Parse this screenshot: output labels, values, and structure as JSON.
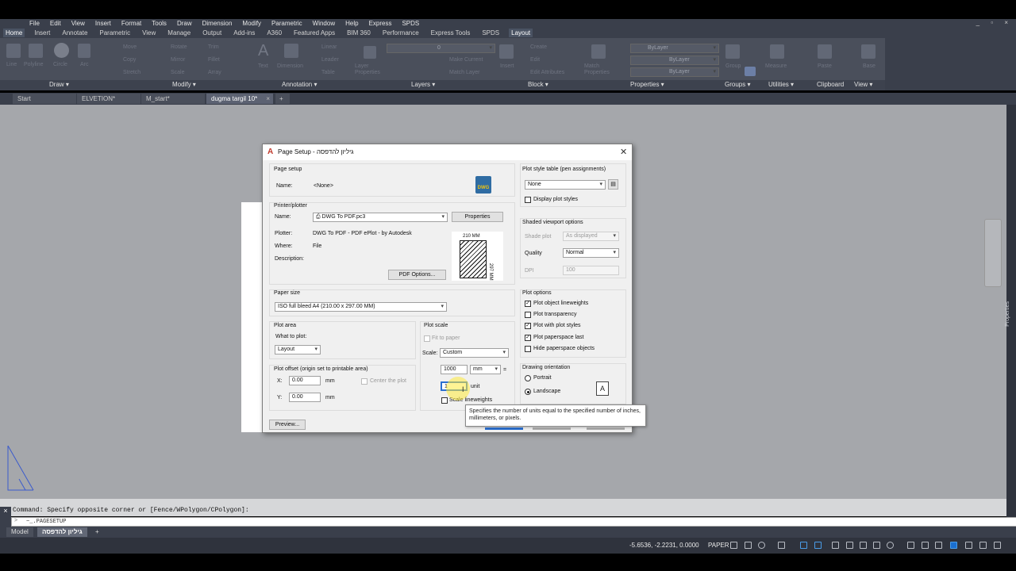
{
  "menu": [
    "File",
    "Edit",
    "View",
    "Insert",
    "Format",
    "Tools",
    "Draw",
    "Dimension",
    "Modify",
    "Parametric",
    "Window",
    "Help",
    "Express",
    "SPDS"
  ],
  "window_controls": "_ ▫ ×",
  "ribbon_tabs": [
    "Home",
    "Insert",
    "Annotate",
    "Parametric",
    "View",
    "Manage",
    "Output",
    "Add-ins",
    "A360",
    "Featured Apps",
    "BIM 360",
    "Performance",
    "Express Tools",
    "SPDS",
    "Layout"
  ],
  "ribbon_active_tab": "Home",
  "ribbon_panels": {
    "draw": "Draw ▾",
    "modify": "Modify ▾",
    "annotation": "Annotation ▾",
    "layers": "Layers ▾",
    "block": "Block ▾",
    "properties": "Properties ▾",
    "groups": "Groups ▾",
    "utilities": "Utilities ▾",
    "clipboard": "Clipboard",
    "view": "View ▾"
  },
  "ribbon_tools": {
    "line": "Line",
    "polyline": "Polyline",
    "circle": "Circle",
    "arc": "Arc",
    "move": "Move",
    "rotate": "Rotate",
    "trim": "Trim",
    "copy": "Copy",
    "mirror": "Mirror",
    "fillet": "Fillet",
    "stretch": "Stretch",
    "scale": "Scale",
    "array": "Array",
    "text": "Text",
    "dimension": "Dimension",
    "linear": "Linear",
    "leader": "Leader",
    "table": "Table",
    "layer_properties": "Layer Properties",
    "make_current": "Make Current",
    "match_layer": "Match Layer",
    "layer_value": "0",
    "insert": "Insert",
    "create": "Create",
    "edit": "Edit",
    "edit_attributes": "Edit Attributes",
    "match_properties": "Match Properties",
    "bylayer": "ByLayer",
    "group": "Group",
    "measure": "Measure",
    "paste": "Paste",
    "base": "Base"
  },
  "file_tabs": [
    {
      "label": "Start",
      "active": false
    },
    {
      "label": "ELVETION*",
      "active": false
    },
    {
      "label": "M_start*",
      "active": false
    },
    {
      "label": "dugma targil 10*",
      "active": true
    }
  ],
  "dialog": {
    "title": "Page Setup - גיליון להדפסה",
    "page_setup": {
      "group": "Page setup",
      "name_label": "Name:",
      "name_value": "<None>",
      "dwg_label": "DWG"
    },
    "printer": {
      "group": "Printer/plotter",
      "name_label": "Name:",
      "name_value": "DWG To PDF.pc3",
      "properties_btn": "Properties",
      "plotter_label": "Plotter:",
      "plotter_value": "DWG To PDF - PDF ePlot - by Autodesk",
      "where_label": "Where:",
      "where_value": "File",
      "description_label": "Description:",
      "pdf_options_btn": "PDF Options...",
      "preview_width": "210 MM",
      "preview_height": "297 MM"
    },
    "paper_size": {
      "group": "Paper size",
      "value": "ISO full bleed A4 (210.00 x 297.00 MM)"
    },
    "plot_area": {
      "group": "Plot area",
      "what_label": "What to plot:",
      "what_value": "Layout"
    },
    "plot_offset": {
      "group": "Plot offset (origin set to printable area)",
      "x_label": "X:",
      "x_value": "0.00",
      "x_unit": "mm",
      "y_label": "Y:",
      "y_value": "0.00",
      "y_unit": "mm",
      "center_label": "Center the plot"
    },
    "plot_scale": {
      "group": "Plot scale",
      "fit_label": "Fit to paper",
      "scale_label": "Scale:",
      "scale_value": "Custom",
      "value1": "1000",
      "unit1": "mm",
      "equals": "=",
      "value2": "1",
      "unit2": "unit",
      "scale_lineweights": "Scale lineweights"
    },
    "plot_style_table": {
      "group": "Plot style table (pen assignments)",
      "value": "None",
      "display_label": "Display plot styles"
    },
    "shaded_viewport": {
      "group": "Shaded viewport options",
      "shade_label": "Shade plot",
      "shade_value": "As displayed",
      "quality_label": "Quality",
      "quality_value": "Normal",
      "dpi_label": "DPI",
      "dpi_value": "100"
    },
    "plot_options": {
      "group": "Plot options",
      "items": [
        {
          "label": "Plot object lineweights",
          "checked": true
        },
        {
          "label": "Plot transparency",
          "checked": false
        },
        {
          "label": "Plot with plot styles",
          "checked": true
        },
        {
          "label": "Plot paperspace last",
          "checked": true
        },
        {
          "label": "Hide paperspace objects",
          "checked": false
        }
      ]
    },
    "orientation": {
      "group": "Drawing orientation",
      "portrait": "Portrait",
      "landscape": "Landscape",
      "selected": "Landscape",
      "icon_glyph": "A"
    },
    "preview_btn": "Preview...",
    "tooltip": "Specifies the number of units equal to the specified number of inches, millimeters, or pixels."
  },
  "command_line": {
    "history": "Command: Specify opposite corner or [Fence/WPolygon/CPolygon]:",
    "input": "~_.PAGESETUP",
    "prompt_glyph": ">"
  },
  "layout_tabs": [
    {
      "label": "Model",
      "active": false
    },
    {
      "label": "גיליון להדפסה",
      "active": true
    },
    {
      "label": "+",
      "active": false
    }
  ],
  "status": {
    "coords": "-5.6536, -2.2231, 0.0000",
    "space": "PAPER"
  },
  "properties_palette_label": "Properties"
}
